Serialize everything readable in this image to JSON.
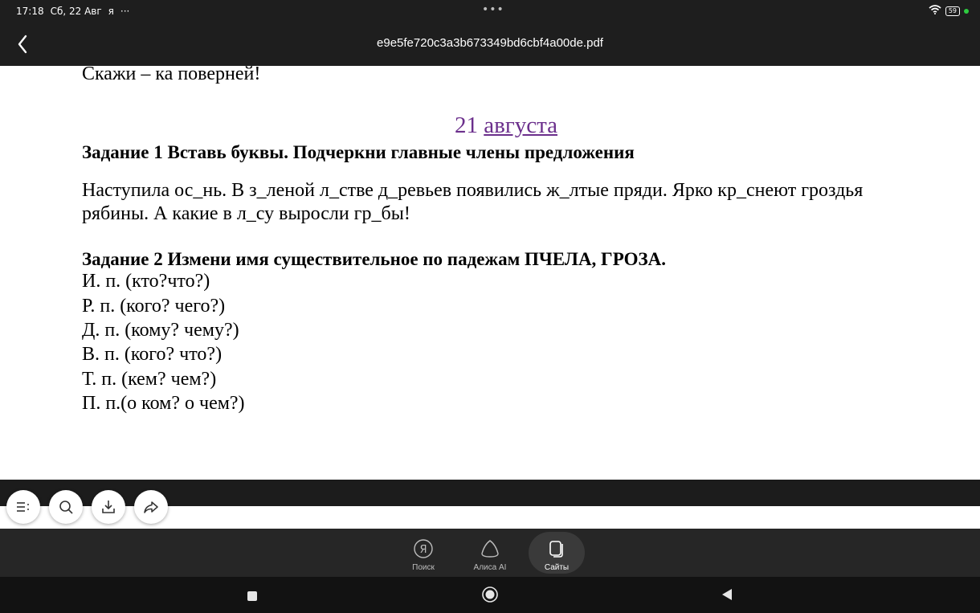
{
  "status_bar": {
    "time": "17:18",
    "date": "Сб, 22 Авг",
    "app_glyph": "я",
    "more": "···",
    "center_dots": "•••",
    "battery": "59"
  },
  "title_bar": {
    "title": "e9e5fe720c3a3b673349bd6cbf4a00de.pdf"
  },
  "document": {
    "top_line": "Скажи – ка поверней!",
    "date_day": "21",
    "date_month": "августа",
    "task1_heading": "Задание 1 Вставь буквы. Подчеркни главные члены предложения",
    "task1_text_line1": "Наступила ос_нь. В з_леной  л_стве  д_ревьев появились ж_лтые пряди. Ярко кр_снеют гроздья",
    "task1_text_line2": "рябины. А какие в л_су выросли гр_бы!",
    "task2_heading": "Задание 2 Измени имя существительное по падежам ПЧЕЛА, ГРОЗА.",
    "cases": [
      "И. п. (кто?что?)",
      "Р. п. (кого? чего?)",
      "Д. п. (кому? чему?)",
      "В. п. (кого? что?)",
      "Т. п. (кем? чем?)",
      "П. п.(о ком? о чем?)"
    ]
  },
  "toolbar": {
    "buttons": [
      "menu-icon",
      "search-icon",
      "download-icon",
      "share-icon"
    ]
  },
  "bottom_nav": {
    "items": [
      {
        "label": "Поиск",
        "icon": "yandex-icon"
      },
      {
        "label": "Алиса AI",
        "icon": "alice-icon"
      },
      {
        "label": "Сайты",
        "icon": "tabs-icon"
      }
    ],
    "active": "Сайты"
  },
  "colors": {
    "chrome_dark": "#1e1e1e",
    "date_purple": "#6b2f8c",
    "battery_green": "#2ecc40"
  }
}
